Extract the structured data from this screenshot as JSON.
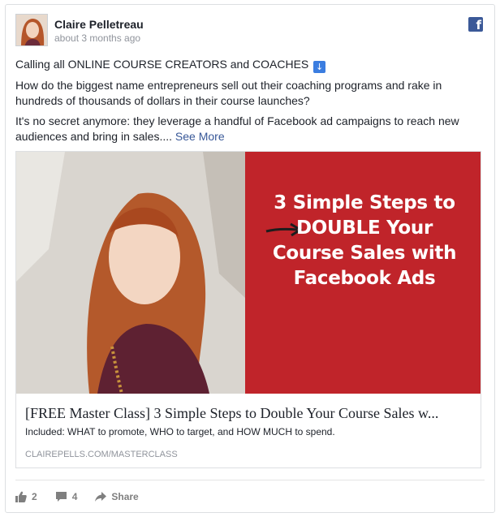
{
  "post": {
    "author": "Claire Pelletreau",
    "timestamp": "about 3 months ago",
    "network_icon": "facebook-icon",
    "paragraphs": [
      "Calling all ONLINE COURSE CREATORS and COACHES",
      "How do the biggest name entrepreneurs sell out their coaching programs and rake in hundreds of thousands of dollars in their course launches?",
      "It's no secret anymore: they leverage a handful of Facebook ad campaigns to reach new audiences and bring in sales...."
    ],
    "see_more": "See More"
  },
  "link_card": {
    "image_text_lines": [
      "3 Simple Steps to",
      "DOUBLE Your",
      "Course Sales with",
      "Facebook Ads"
    ],
    "title": "[FREE Master Class] 3 Simple Steps to Double Your Course Sales w...",
    "description": "Included: WHAT to promote, WHO to target, and HOW MUCH to spend.",
    "domain": "CLAIREPELLS.COM/MASTERCLASS"
  },
  "actions": {
    "likes": "2",
    "comments": "4",
    "share_label": "Share"
  },
  "colors": {
    "brand_blue": "#3b5998",
    "promo_red": "#c0242a",
    "link_blue": "#385898"
  }
}
